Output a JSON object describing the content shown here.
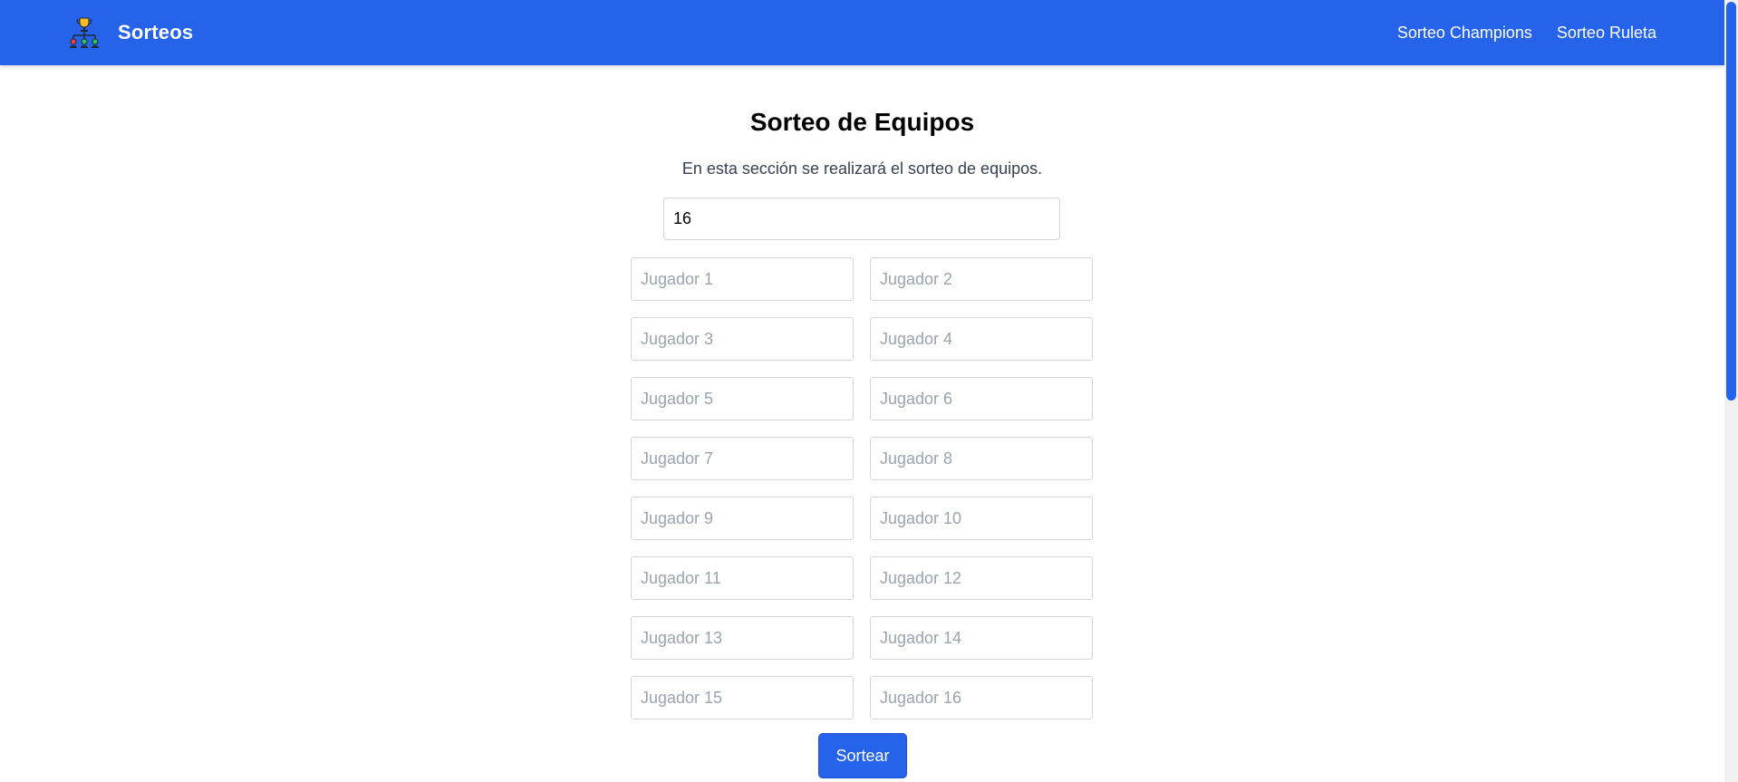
{
  "navbar": {
    "brand": "Sorteos",
    "logo_icon": "tournament-bracket-icon",
    "links": [
      "Sorteo Champions",
      "Sorteo Ruleta"
    ],
    "color": "#2563eb"
  },
  "main": {
    "title": "Sorteo de Equipos",
    "subtitle": "En esta sección se realizará el sorteo de equipos.",
    "count_value": "16",
    "players": [
      "Jugador 1",
      "Jugador 2",
      "Jugador 3",
      "Jugador 4",
      "Jugador 5",
      "Jugador 6",
      "Jugador 7",
      "Jugador 8",
      "Jugador 9",
      "Jugador 10",
      "Jugador 11",
      "Jugador 12",
      "Jugador 13",
      "Jugador 14",
      "Jugador 15",
      "Jugador 16"
    ],
    "submit_label": "Sortear"
  }
}
